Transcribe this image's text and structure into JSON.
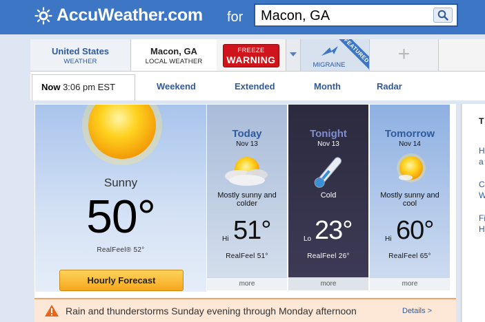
{
  "header": {
    "logo_text": "AccuWeather.com",
    "for_label": "for",
    "search_value": "Macon, GA"
  },
  "location_tabs": {
    "us": {
      "title": "United States",
      "subtitle": "WEATHER"
    },
    "local": {
      "title": "Macon, GA",
      "subtitle": "LOCAL WEATHER"
    },
    "freeze": {
      "line1": "FREEZE",
      "line2": "WARNING"
    },
    "migraine": {
      "label": "MIGRAINE",
      "badge": "FEATURED"
    },
    "add_symbol": "+"
  },
  "nav": {
    "now_label": "Now",
    "now_time": "3:06 pm EST",
    "items": [
      "Weekend",
      "Extended",
      "Month",
      "Radar"
    ]
  },
  "current": {
    "condition": "Sunny",
    "temperature": "50°",
    "realfeel": "RealFeel® 52°",
    "hourly_button": "Hourly Forecast"
  },
  "forecast": [
    {
      "day": "Today",
      "date": "Nov 13",
      "desc": "Mostly sunny and colder",
      "hilo": "Hi",
      "temp": "51°",
      "realfeel": "RealFeel 51°",
      "more": "more"
    },
    {
      "day": "Tonight",
      "date": "Nov 13",
      "desc": "Cold",
      "hilo": "Lo",
      "temp": "23°",
      "realfeel": "RealFeel 26°",
      "more": "more"
    },
    {
      "day": "Tomorrow",
      "date": "Nov 14",
      "desc": "Mostly sunny and cool",
      "hilo": "Hi",
      "temp": "60°",
      "realfeel": "RealFeel 65°",
      "more": "more"
    }
  ],
  "alert": {
    "text": "Rain and thunderstorms Sunday evening through Monday afternoon",
    "details": "Details >"
  },
  "right_column": {
    "lines": [
      "T",
      "H",
      "a",
      "C",
      "W",
      "Fi",
      "H"
    ]
  },
  "colors": {
    "header_blue": "#3e76c6",
    "link_blue": "#2e5a9c",
    "warning_red": "#d0141b",
    "sun_yellow": "#f7c21a",
    "button_orange": "#f5a81c"
  }
}
